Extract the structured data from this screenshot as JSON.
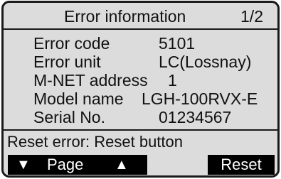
{
  "header": {
    "title": "Error information",
    "page_indicator": "1/2"
  },
  "error_info": {
    "error_code_label": "Error code",
    "error_code_value": "5101",
    "error_unit_label": "Error unit",
    "error_unit_value": "LC(Lossnay)",
    "mnet_address_label": "M-NET address",
    "mnet_address_value": "1",
    "model_name_label": "Model name",
    "model_name_value": "LGH-100RVX-E",
    "serial_no_label": "Serial No.",
    "serial_no_value": "01234567"
  },
  "footer": {
    "reset_hint": "Reset error: Reset button",
    "page_down_icon": "▼",
    "page_label": "Page",
    "page_up_icon": "▲",
    "reset_label": "Reset"
  }
}
